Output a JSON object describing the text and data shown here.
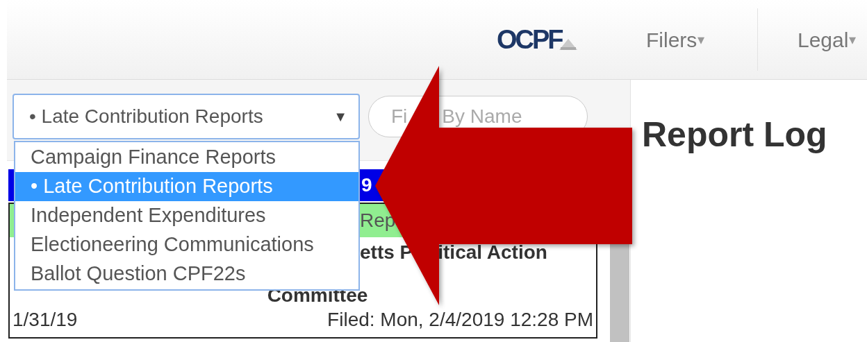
{
  "header": {
    "logo": "OCPF",
    "nav": [
      {
        "label": "Filers",
        "caret": "▾"
      },
      {
        "label": "Legal",
        "caret": "▾"
      }
    ]
  },
  "report_filter": {
    "value": "• Late Contribution Reports",
    "caret": "▼",
    "open": true,
    "options": [
      {
        "label": "Campaign Finance Reports",
        "selected": false
      },
      {
        "label": "• Late Contribution Reports",
        "selected": true
      },
      {
        "label": "Independent Expenditures",
        "selected": false
      },
      {
        "label": "Electioneering Communications",
        "selected": false
      },
      {
        "label": "Ballot Question CPF22s",
        "selected": false
      }
    ]
  },
  "name_filter": {
    "placeholder_parts": [
      "Fi",
      "By Name"
    ]
  },
  "report_list": {
    "header_bar_text": "9",
    "status_badge_text": "Rep",
    "card": {
      "title_parts": [
        "etts P",
        "itical Action"
      ],
      "title_line_2": "Committee",
      "date": "1/31/19",
      "filed": "Filed: Mon, 2/4/2019 12:28 PM"
    }
  },
  "main": {
    "heading": "Report Log"
  }
}
